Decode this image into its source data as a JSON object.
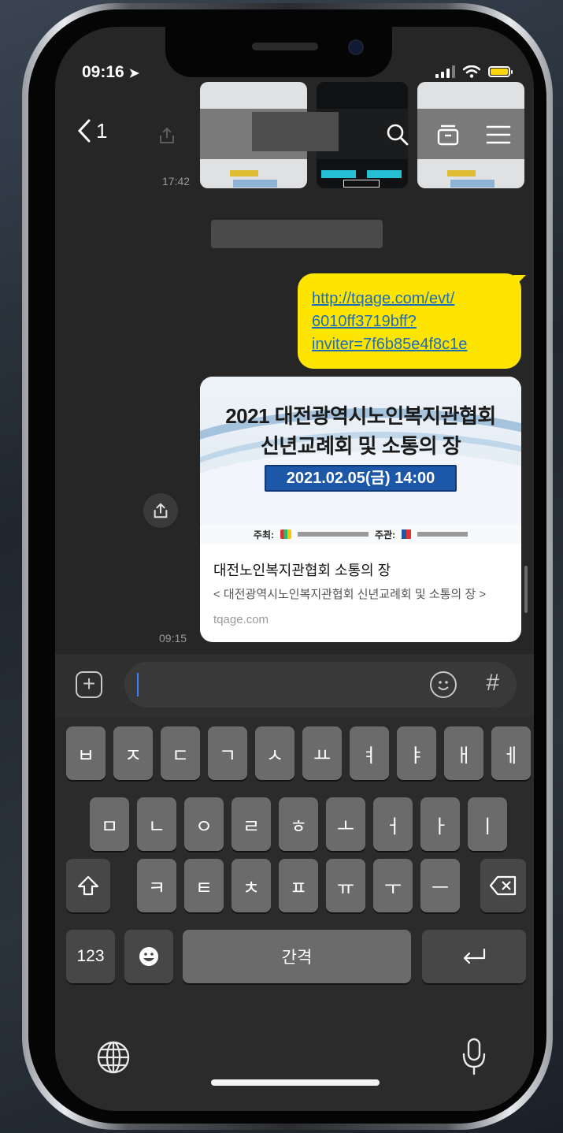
{
  "status": {
    "time": "09:16",
    "battery_color": "#ffd60a"
  },
  "nav": {
    "back_count": "1"
  },
  "thumb_time": "17:42",
  "message": {
    "lines": [
      "http://tqage.com/evt/",
      "6010ff3719bff?",
      "inviter=7f6b85e4f8c1e"
    ],
    "bubble_color": "#fee500"
  },
  "card": {
    "banner_line1": "2021 대전광역시노인복지관협회",
    "banner_line2": "신년교례회 및 소통의 장",
    "banner_date": "2021.02.05(금) 14:00",
    "host_label": "주최:",
    "org_label": "주관:",
    "title": "대전노인복지관협회 소통의 장",
    "description": "< 대전광역시노인복지관협회 신년교례회 및 소통의 장 >",
    "domain": "tqage.com",
    "time": "09:15"
  },
  "input": {
    "hash_label": "#"
  },
  "keyboard": {
    "row1": [
      "ㅂ",
      "ㅈ",
      "ㄷ",
      "ㄱ",
      "ㅅ",
      "ㅛ",
      "ㅕ",
      "ㅑ",
      "ㅐ",
      "ㅔ"
    ],
    "row2": [
      "ㅁ",
      "ㄴ",
      "ㅇ",
      "ㄹ",
      "ㅎ",
      "ㅗ",
      "ㅓ",
      "ㅏ",
      "ㅣ"
    ],
    "row3": [
      "ㅋ",
      "ㅌ",
      "ㅊ",
      "ㅍ",
      "ㅠ",
      "ㅜ",
      "ㅡ"
    ],
    "numbers_label": "123",
    "space_label": "간격"
  }
}
